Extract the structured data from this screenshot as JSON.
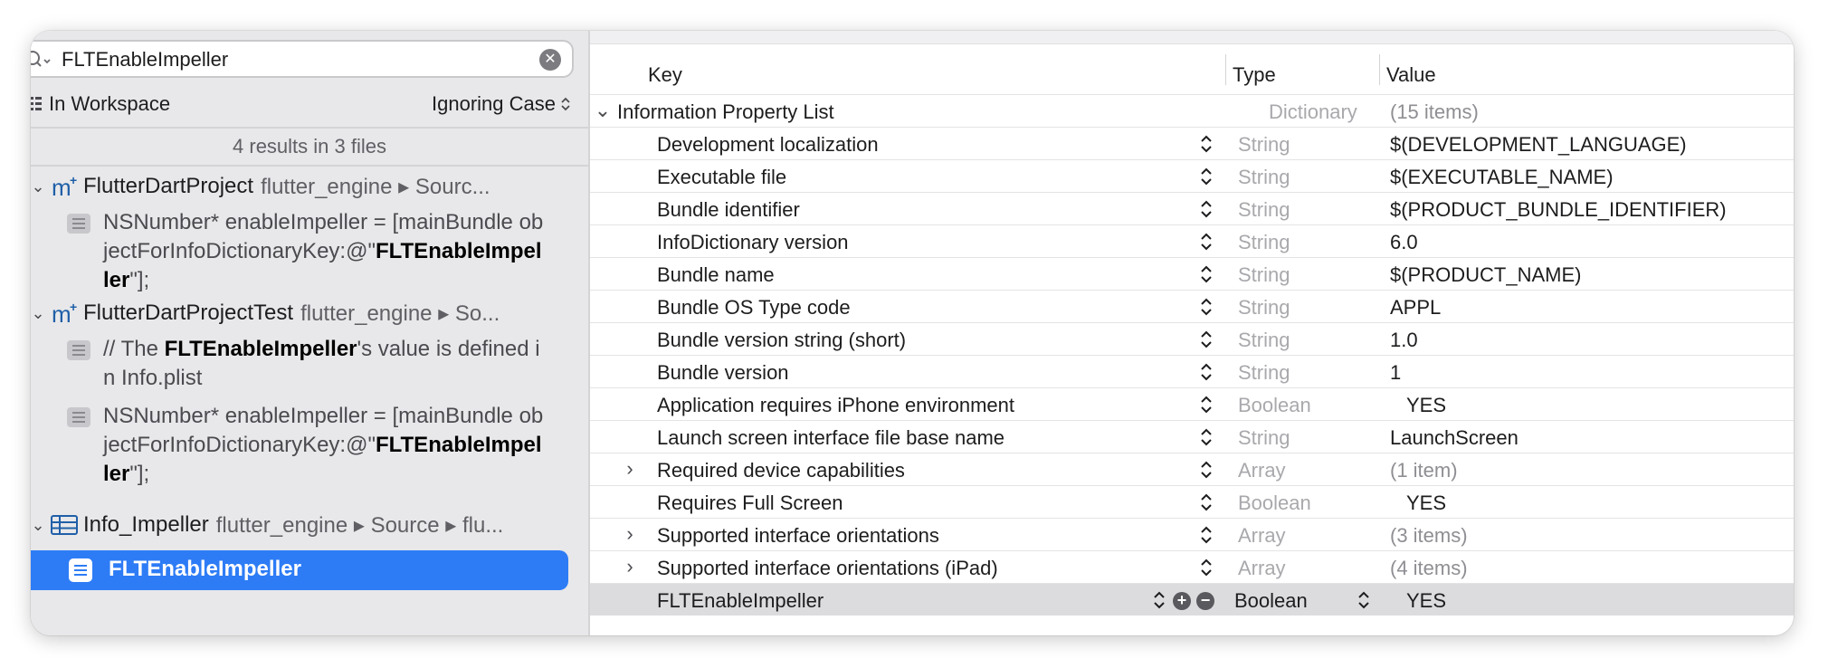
{
  "search": {
    "query": "FLTEnableImpeller",
    "scope": "In Workspace",
    "matching": "Ignoring Case",
    "summary": "4 results in 3 files"
  },
  "results": {
    "files": [
      {
        "name": "FlutterDartProject",
        "path": "flutter_engine ▸ Sourc...",
        "icon": "objc-m-file-icon",
        "matches": [
          {
            "pre": "NSNumber* enableImpeller = [mainBundle objectForInfoDictionaryKey:@\"",
            "hit": "FLTEnableImpeller",
            "post": "\"];"
          }
        ]
      },
      {
        "name": "FlutterDartProjectTest",
        "path": "flutter_engine ▸ So...",
        "icon": "objc-m-file-icon",
        "matches": [
          {
            "pre": "// The ",
            "hit": "FLTEnableImpeller",
            "post": "'s value is defined in Info.plist"
          },
          {
            "pre": "NSNumber* enableImpeller = [mainBundle objectForInfoDictionaryKey:@\"",
            "hit": "FLTEnableImpeller",
            "post": "\"];"
          }
        ]
      },
      {
        "name": "Info_Impeller",
        "path": "flutter_engine ▸ Source ▸ flu...",
        "icon": "plist-table-icon",
        "matches": [
          {
            "text": "FLTEnableImpeller",
            "selected": true
          }
        ]
      }
    ]
  },
  "plist": {
    "headers": {
      "key": "Key",
      "type": "Type",
      "value": "Value"
    },
    "root": {
      "key": "Information Property List",
      "type": "Dictionary",
      "value": "(15 items)"
    },
    "rows": [
      {
        "key": "Development localization",
        "type": "String",
        "value": "$(DEVELOPMENT_LANGUAGE)"
      },
      {
        "key": "Executable file",
        "type": "String",
        "value": "$(EXECUTABLE_NAME)"
      },
      {
        "key": "Bundle identifier",
        "type": "String",
        "value": "$(PRODUCT_BUNDLE_IDENTIFIER)"
      },
      {
        "key": "InfoDictionary version",
        "type": "String",
        "value": "6.0"
      },
      {
        "key": "Bundle name",
        "type": "String",
        "value": "$(PRODUCT_NAME)"
      },
      {
        "key": "Bundle OS Type code",
        "type": "String",
        "value": "APPL"
      },
      {
        "key": "Bundle version string (short)",
        "type": "String",
        "value": "1.0"
      },
      {
        "key": "Bundle version",
        "type": "String",
        "value": "1"
      },
      {
        "key": "Application requires iPhone environment",
        "type": "Boolean",
        "value": "YES"
      },
      {
        "key": "Launch screen interface file base name",
        "type": "String",
        "value": "LaunchScreen"
      },
      {
        "key": "Required device capabilities",
        "type": "Array",
        "value": "(1 item)"
      },
      {
        "key": "Requires Full Screen",
        "type": "Boolean",
        "value": "YES"
      },
      {
        "key": "Supported interface orientations",
        "type": "Array",
        "value": "(3 items)"
      },
      {
        "key": "Supported interface orientations (iPad)",
        "type": "Array",
        "value": "(4 items)"
      },
      {
        "key": "FLTEnableImpeller",
        "type": "Boolean",
        "value": "YES"
      }
    ]
  },
  "colors": {
    "selection_blue": "#2d7cf6",
    "sidebar_bg": "#e8e8ea",
    "selected_row_gray": "#dcdcde",
    "dim_text": "#a9a9ad"
  }
}
